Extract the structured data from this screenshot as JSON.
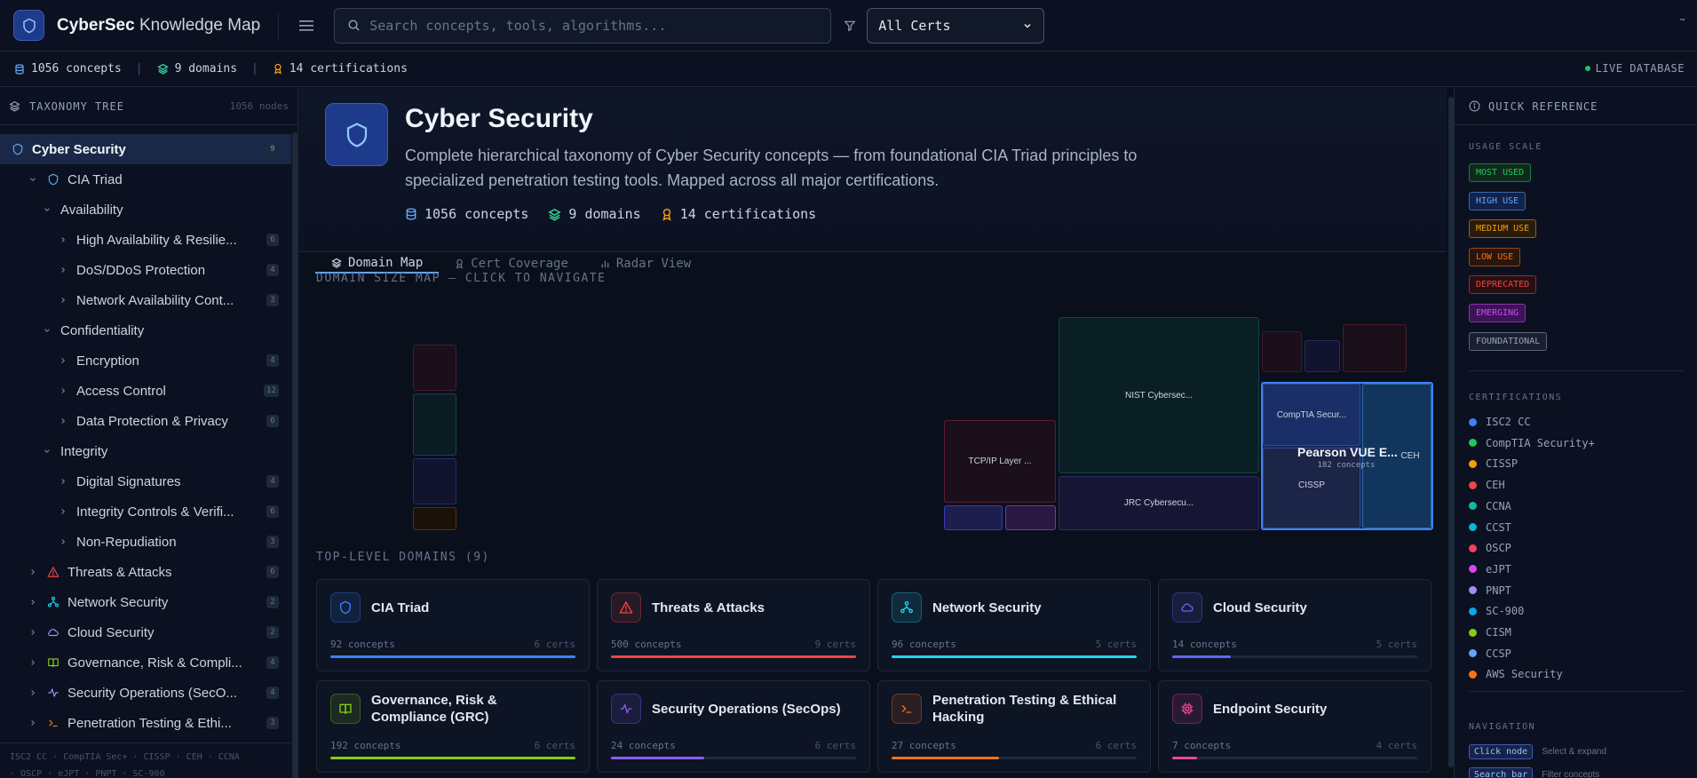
{
  "app": {
    "title_bold": "CyberSec",
    "title_rest": " Knowledge Map",
    "menu_icon": "hamburger-icon"
  },
  "search": {
    "placeholder": "Search concepts, tools, algorithms..."
  },
  "filter": {
    "selected": "All Certs"
  },
  "stats": {
    "concepts": "1056 concepts",
    "domains": "9 domains",
    "certifications": "14 certifications",
    "live": "LIVE DATABASE"
  },
  "sidebar": {
    "header": "TAXONOMY TREE",
    "node_count": "1056 nodes",
    "footer_line1": "ISC2 CC · CompTIA Sec+ · CISSP · CEH · CCNA",
    "footer_line2": "· OSCP · eJPT · PNPT · SC-900",
    "tree": [
      {
        "label": "Cyber Security",
        "badge": "9",
        "level": 0,
        "chev": "",
        "icon": "shield",
        "color": "#60a5fa",
        "active": true
      },
      {
        "label": "CIA Triad",
        "badge": "",
        "level": 1,
        "chev": "v",
        "icon": "shield",
        "color": "#60a5fa"
      },
      {
        "label": "Availability",
        "badge": "",
        "level": 2,
        "chev": "v",
        "icon": "",
        "color": ""
      },
      {
        "label": "High Availability & Resilie...",
        "badge": "6",
        "level": 3,
        "chev": ">",
        "icon": "",
        "color": ""
      },
      {
        "label": "DoS/DDoS Protection",
        "badge": "4",
        "level": 3,
        "chev": ">",
        "icon": "",
        "color": ""
      },
      {
        "label": "Network Availability Cont...",
        "badge": "3",
        "level": 3,
        "chev": ">",
        "icon": "",
        "color": ""
      },
      {
        "label": "Confidentiality",
        "badge": "",
        "level": 2,
        "chev": "v",
        "icon": "",
        "color": ""
      },
      {
        "label": "Encryption",
        "badge": "4",
        "level": 3,
        "chev": ">",
        "icon": "",
        "color": ""
      },
      {
        "label": "Access Control",
        "badge": "12",
        "level": 3,
        "chev": ">",
        "icon": "",
        "color": ""
      },
      {
        "label": "Data Protection & Privacy",
        "badge": "6",
        "level": 3,
        "chev": ">",
        "icon": "",
        "color": ""
      },
      {
        "label": "Integrity",
        "badge": "",
        "level": 2,
        "chev": "v",
        "icon": "",
        "color": ""
      },
      {
        "label": "Digital Signatures",
        "badge": "4",
        "level": 3,
        "chev": ">",
        "icon": "",
        "color": ""
      },
      {
        "label": "Integrity Controls & Verifi...",
        "badge": "6",
        "level": 3,
        "chev": ">",
        "icon": "",
        "color": ""
      },
      {
        "label": "Non-Repudiation",
        "badge": "3",
        "level": 3,
        "chev": ">",
        "icon": "",
        "color": ""
      },
      {
        "label": "Threats & Attacks",
        "badge": "6",
        "level": 1,
        "chev": ">",
        "icon": "warning",
        "color": "#ef4444"
      },
      {
        "label": "Network Security",
        "badge": "2",
        "level": 1,
        "chev": ">",
        "icon": "network",
        "color": "#22d3ee"
      },
      {
        "label": "Cloud Security",
        "badge": "2",
        "level": 1,
        "chev": ">",
        "icon": "cloud",
        "color": "#8b9cf6"
      },
      {
        "label": "Governance, Risk & Compli...",
        "badge": "4",
        "level": 1,
        "chev": ">",
        "icon": "book",
        "color": "#84cc16"
      },
      {
        "label": "Security Operations (SecO...",
        "badge": "4",
        "level": 1,
        "chev": ">",
        "icon": "pulse",
        "color": "#a78bfa"
      },
      {
        "label": "Penetration Testing & Ethi...",
        "badge": "3",
        "level": 1,
        "chev": ">",
        "icon": "terminal",
        "color": "#f97316"
      }
    ]
  },
  "hero": {
    "title": "Cyber Security",
    "description": "Complete hierarchical taxonomy of Cyber Security concepts — from foundational CIA Triad principles to specialized penetration testing tools. Mapped across all major certifications.",
    "concepts": "1056 concepts",
    "domains": "9 domains",
    "certifications": "14 certifications"
  },
  "tabs": [
    {
      "label": "Domain Map",
      "icon": "layers-icon",
      "active": true
    },
    {
      "label": "Cert Coverage",
      "icon": "award-icon",
      "active": false
    },
    {
      "label": "Radar View",
      "icon": "bar-chart-icon",
      "active": false
    }
  ],
  "map": {
    "label": "DOMAIN SIZE MAP — CLICK TO NAVIGATE",
    "tiles": {
      "nist": "NIST Cybersec...",
      "tcpip": "TCP/IP Layer ...",
      "jrc": "JRC Cybersecu...",
      "comptia": "CompTIA Secur...",
      "cissp": "CISSP",
      "ceh": "CEH",
      "hover_title": "Pearson VUE E...",
      "hover_sub": "182 concepts"
    }
  },
  "domains_section": {
    "label": "TOP-LEVEL DOMAINS (9)"
  },
  "domains": [
    {
      "name": "CIA Triad",
      "concepts": "92 concepts",
      "certs": "6 certs",
      "icon": "shield-icon",
      "color": "#3b82f6",
      "fill": 1.0
    },
    {
      "name": "Threats & Attacks",
      "concepts": "500 concepts",
      "certs": "9 certs",
      "icon": "warning-icon",
      "color": "#ef4444",
      "fill": 1.0
    },
    {
      "name": "Network Security",
      "concepts": "96 concepts",
      "certs": "5 certs",
      "icon": "network-icon",
      "color": "#22d3ee",
      "fill": 1.0
    },
    {
      "name": "Cloud Security",
      "concepts": "14 concepts",
      "certs": "5 certs",
      "icon": "cloud-icon",
      "color": "#6366f1",
      "fill": 0.24
    },
    {
      "name": "Governance, Risk & Compliance (GRC)",
      "concepts": "192 concepts",
      "certs": "6 certs",
      "icon": "book-icon",
      "color": "#84cc16",
      "fill": 1.0
    },
    {
      "name": "Security Operations (SecOps)",
      "concepts": "24 concepts",
      "certs": "6 certs",
      "icon": "pulse-icon",
      "color": "#8b5cf6",
      "fill": 0.38
    },
    {
      "name": "Penetration Testing & Ethical Hacking",
      "concepts": "27 concepts",
      "certs": "6 certs",
      "icon": "terminal-icon",
      "color": "#f97316",
      "fill": 0.44
    },
    {
      "name": "Endpoint Security",
      "concepts": "7 concepts",
      "certs": "4 certs",
      "icon": "cpu-icon",
      "color": "#ec4899",
      "fill": 0.1
    }
  ],
  "right": {
    "header": "QUICK REFERENCE",
    "usage_label": "USAGE SCALE",
    "usage": [
      {
        "label": "MOST USED",
        "color": "#22c55e",
        "bg": "#0f2a1c"
      },
      {
        "label": "HIGH USE",
        "color": "#60a5fa",
        "bg": "#12224a"
      },
      {
        "label": "MEDIUM USE",
        "color": "#f59e0b",
        "bg": "#2a1c0b"
      },
      {
        "label": "LOW USE",
        "color": "#f97316",
        "bg": "#2a160b"
      },
      {
        "label": "DEPRECATED",
        "color": "#ef4444",
        "bg": "#2a0f12"
      },
      {
        "label": "EMERGING",
        "color": "#d946ef",
        "bg": "#3a1457"
      },
      {
        "label": "FOUNDATIONAL",
        "color": "#94a3b8",
        "bg": "#1a2030"
      }
    ],
    "certs_label": "CERTIFICATIONS",
    "certs": [
      {
        "name": "ISC2 CC",
        "color": "#3b82f6"
      },
      {
        "name": "CompTIA Security+",
        "color": "#22c55e"
      },
      {
        "name": "CISSP",
        "color": "#f59e0b"
      },
      {
        "name": "CEH",
        "color": "#ef4444"
      },
      {
        "name": "CCNA",
        "color": "#14b8a6"
      },
      {
        "name": "CCST",
        "color": "#06b6d4"
      },
      {
        "name": "OSCP",
        "color": "#f43f5e"
      },
      {
        "name": "eJPT",
        "color": "#d946ef"
      },
      {
        "name": "PNPT",
        "color": "#a78bfa"
      },
      {
        "name": "SC-900",
        "color": "#0ea5e9"
      },
      {
        "name": "CISM",
        "color": "#84cc16"
      },
      {
        "name": "CCSP",
        "color": "#60a5fa"
      },
      {
        "name": "AWS Security",
        "color": "#f97316"
      }
    ],
    "nav_label": "NAVIGATION",
    "nav": [
      {
        "key": "Click node",
        "desc": "Select & expand"
      },
      {
        "key": "Search bar",
        "desc": "Filter concepts"
      }
    ]
  }
}
